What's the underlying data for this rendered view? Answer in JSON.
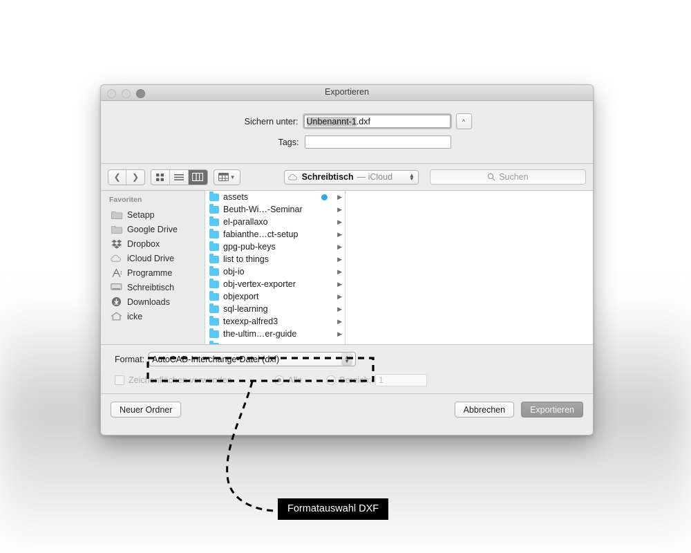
{
  "window": {
    "title": "Exportieren",
    "traffic_lights": [
      "close",
      "minimize",
      "zoom"
    ]
  },
  "save_panel": {
    "name_label": "Sichern unter:",
    "name_value_selected": "Unbenannt-1",
    "name_value_rest": ".dxf",
    "name_full": "Unbenannt-1.dxf",
    "expand_icon": "chevron-up-icon",
    "tags_label": "Tags:",
    "tags_value": "",
    "tags_placeholder": ""
  },
  "toolbar": {
    "back_icon": "chevron-left-icon",
    "forward_icon": "chevron-right-icon",
    "view_icon_grid": "grid-view-icon",
    "view_list": "list-view-icon",
    "view_column": "column-view-icon",
    "arrange_icon": "arrange-by-icon",
    "arrange_chevron": "chevron-down-icon",
    "path_icon": "icloud-icon",
    "path_name": "Schreibtisch",
    "path_suffix": "— iCloud",
    "path_stepper_up": "▲",
    "path_stepper_down": "▼",
    "search_icon": "search-icon",
    "search_placeholder": "Suchen",
    "search_value": ""
  },
  "sidebar": {
    "header": "Favoriten",
    "items": [
      {
        "label": "Setapp",
        "icon": "folder-icon"
      },
      {
        "label": "Google Drive",
        "icon": "folder-icon"
      },
      {
        "label": "Dropbox",
        "icon": "dropbox-icon"
      },
      {
        "label": "iCloud Drive",
        "icon": "icloud-icon"
      },
      {
        "label": "Programme",
        "icon": "applications-icon"
      },
      {
        "label": "Schreibtisch",
        "icon": "desktop-icon"
      },
      {
        "label": "Downloads",
        "icon": "downloads-icon"
      },
      {
        "label": "icke",
        "icon": "home-icon"
      }
    ]
  },
  "file_list": {
    "rows": [
      {
        "name": "assets",
        "tag_dot": true,
        "chevron": true
      },
      {
        "name": "Beuth-Wi…-Seminar",
        "tag_dot": false,
        "chevron": true
      },
      {
        "name": "el-parallaxo",
        "tag_dot": false,
        "chevron": true
      },
      {
        "name": "fabianthe…ct-setup",
        "tag_dot": false,
        "chevron": true
      },
      {
        "name": "gpg-pub-keys",
        "tag_dot": false,
        "chevron": true
      },
      {
        "name": "list to things",
        "tag_dot": false,
        "chevron": true
      },
      {
        "name": "obj-io",
        "tag_dot": false,
        "chevron": true
      },
      {
        "name": "obj-vertex-exporter",
        "tag_dot": false,
        "chevron": true
      },
      {
        "name": "objexport",
        "tag_dot": false,
        "chevron": true
      },
      {
        "name": "sql-learning",
        "tag_dot": false,
        "chevron": true
      },
      {
        "name": "texexp-alfred3",
        "tag_dot": false,
        "chevron": true
      },
      {
        "name": "the-ultim…er-guide",
        "tag_dot": false,
        "chevron": true
      }
    ],
    "tag_dot_color": "#2fa8e8",
    "folder_color": "#5ac8f5"
  },
  "format_panel": {
    "label": "Format:",
    "selected_format": "AutoCAD-Interchange-Datei (dxf)",
    "artboards_checkbox_label": "Zeichenflächen verwenden",
    "artboards_checked": false,
    "all_radio_label": "Alle",
    "all_radio_selected": true,
    "range_radio_label": "Bereich:",
    "range_radio_selected": false,
    "range_value": "1"
  },
  "bottom_bar": {
    "new_folder": "Neuer Ordner",
    "cancel": "Abbrechen",
    "export": "Exportieren"
  },
  "annotation": {
    "callout_label": "Formatauswahl DXF",
    "callout_bg": "#000000",
    "callout_fg": "#ffffff",
    "highlight_style": "dashed-rectangle"
  }
}
